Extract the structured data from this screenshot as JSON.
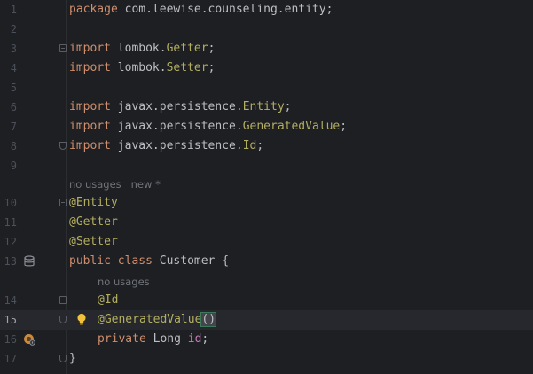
{
  "editor": {
    "lines": [
      {
        "num": "1",
        "text": "package com.leewise.counseling.entity;"
      },
      {
        "num": "2",
        "text": ""
      },
      {
        "num": "3",
        "text": "import lombok.Getter;"
      },
      {
        "num": "4",
        "text": "import lombok.Setter;"
      },
      {
        "num": "5",
        "text": ""
      },
      {
        "num": "6",
        "text": "import javax.persistence.Entity;"
      },
      {
        "num": "7",
        "text": "import javax.persistence.GeneratedValue;"
      },
      {
        "num": "8",
        "text": "import javax.persistence.Id;"
      },
      {
        "num": "9",
        "text": ""
      },
      {
        "num": "10",
        "text": "@Entity"
      },
      {
        "num": "11",
        "text": "@Getter"
      },
      {
        "num": "12",
        "text": "@Setter"
      },
      {
        "num": "13",
        "text": "public class Customer {"
      },
      {
        "num": "14",
        "text": "@Id"
      },
      {
        "num": "15",
        "text": "@GeneratedValue()"
      },
      {
        "num": "16",
        "text": "private Long id;"
      },
      {
        "num": "17",
        "text": "}"
      }
    ],
    "tokens": {
      "package_kw": "package",
      "package_name": " com.leewise.counseling.entity;",
      "import_kw": "import",
      "lombok_pkg": " lombok.",
      "getter_cls": "Getter",
      "setter_cls": "Setter",
      "semicolon": ";",
      "javax_pkg": " javax.persistence.",
      "entity_cls": "Entity",
      "generated_cls": "GeneratedValue",
      "id_cls": "Id",
      "ann_entity": "@Entity",
      "ann_getter": "@Getter",
      "ann_setter": "@Setter",
      "public_kw": "public",
      "class_kw": " class",
      "class_name": " Customer {",
      "ann_id": "@Id",
      "ann_generated": "@GeneratedValue",
      "paren": "()",
      "private_kw": "private",
      "long_type": " Long ",
      "field_id": "id",
      "closing_brace": "}"
    },
    "hints": {
      "class_hint": "no usages   new *",
      "field_hint": "no usages"
    },
    "current_line": "15",
    "colors": {
      "background": "#1e1f22",
      "keyword": "#cf8e6d",
      "annotation": "#b3ae60",
      "field": "#c77dbb",
      "text": "#bcbec4",
      "line_number": "#4b5059"
    },
    "icons": [
      "database-icon",
      "lightbulb-icon",
      "bean-field-icon",
      "fold-icon"
    ]
  }
}
